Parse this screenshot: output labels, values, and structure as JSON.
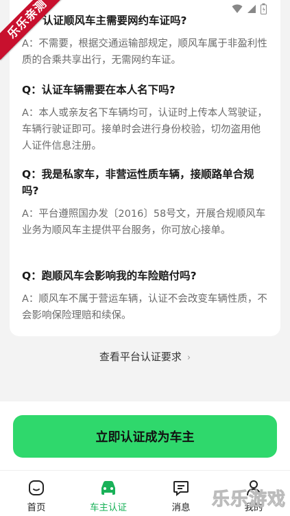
{
  "watermark_ribbon": "乐乐亲测",
  "faq": [
    {
      "q": "认证顺风车主需要网约车证吗?",
      "a": "A：不需要，根据交通运输部规定，顺风车属于非盈利性质的合乘共享出行，无需网约车证。"
    },
    {
      "q": "Q：认证车辆需要在本人名下吗?",
      "a": "A：本人或亲友名下车辆均可，认证时上传本人驾驶证，车辆行驶证即可。接单时会进行身份校验，切勿盗用他人证件信息注册。"
    },
    {
      "q": "Q：我是私家车，非营运性质车辆，接顺路单合规吗?",
      "a": "A：平台遵照国办发〔2016〕58号文，开展合规顺风车业务为顺风车主提供平台服务，你可放心接单。"
    },
    {
      "q": "Q：跑顺风车会影响我的车险赔付吗?",
      "a": "A：顺风车不属于营运车辆，认证不会改变车辆性质，不会影响保险理赔和续保。"
    }
  ],
  "requirements_link": "查看平台认证要求",
  "cta_label": "立即认证成为车主",
  "tabs": [
    {
      "label": "首页",
      "icon": "home-icon"
    },
    {
      "label": "车主认证",
      "icon": "car-icon"
    },
    {
      "label": "消息",
      "icon": "message-icon"
    },
    {
      "label": "我的",
      "icon": "person-icon"
    }
  ],
  "watermark_logo": "乐乐游戏",
  "colors": {
    "accent": "#2fd86c",
    "active_tab": "#19b158",
    "ribbon": "#c8102e"
  }
}
